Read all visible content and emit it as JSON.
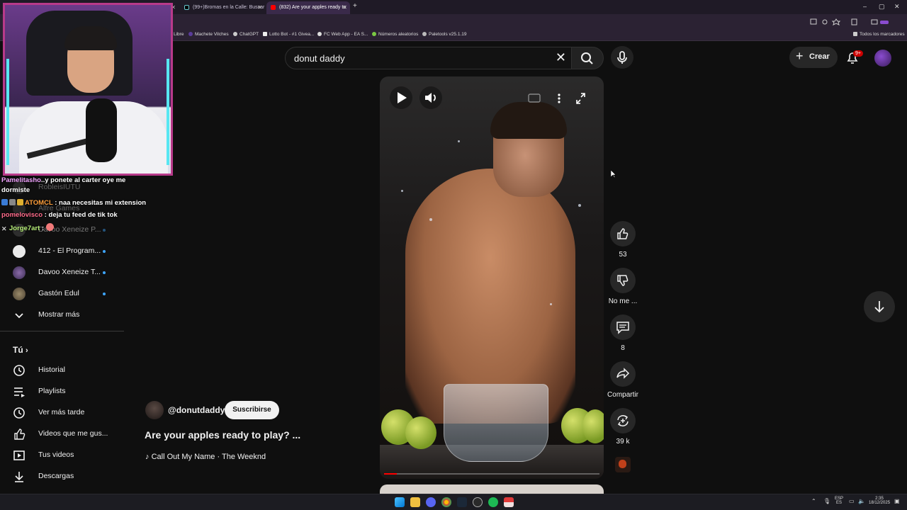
{
  "browser": {
    "tabs": [
      {
        "title": "",
        "active": false
      },
      {
        "title": "(99+)Bromas en la Calle: Buscar",
        "active": false
      },
      {
        "title": "(832) Are your apples ready to",
        "active": true
      }
    ],
    "new_tab": "+",
    "bookmarks": [
      "Libre",
      "Machete Vilches",
      "ChatGPT",
      "Lotto Bot - #1 Givea...",
      "FC Web App - EA S...",
      "Números aleatorios",
      "Paletools v25.1.19"
    ],
    "all_bookmarks": "Todos los marcadores",
    "window_controls": [
      "–",
      "▢",
      "✕"
    ]
  },
  "youtube": {
    "search": {
      "value": "donut daddy",
      "clear_icon": "✕"
    },
    "create_label": "Crear",
    "notifications_badge": "9+"
  },
  "chat": [
    {
      "user": "Pamelitasho",
      "text": "..y ponete al carter oye me",
      "user_color": "#f2a4ff"
    },
    {
      "user": "",
      "text": "dormiste",
      "user_color": "#ffffff"
    },
    {
      "user": "ATOMCL",
      "text": ": naa necesitas mi extension",
      "user_color": "#ff9f3b"
    },
    {
      "user": "pomelovisco",
      "text": ": deja tu feed de tik tok",
      "user_color": "#ff6b8a"
    },
    {
      "user": "Jorge7art",
      "text": ":",
      "user_color": "#b9f27a"
    }
  ],
  "sidebar": {
    "faded_channels": [
      "RobleisIUTU",
      "Alfre Games",
      "Davoo Xeneize P..."
    ],
    "channels": [
      {
        "label": "412 - El Program...",
        "live_dot": true
      },
      {
        "label": "Davoo Xeneize T...",
        "live_dot": true
      },
      {
        "label": "Gastón Edul",
        "live_dot": true
      }
    ],
    "show_more": "Mostrar más",
    "you_header": "Tú",
    "you_items": [
      "Historial",
      "Playlists",
      "Ver más tarde",
      "Videos que me gus...",
      "Tus videos",
      "Descargas"
    ]
  },
  "short": {
    "channel": "@donutdaddy",
    "subscribe_label": "Suscribirse",
    "title": "Are your apples ready to play? ...",
    "music": "Call Out My Name · The Weeknd",
    "progress": 0.06,
    "actions": {
      "likes": "53",
      "dislike_label": "No me ...",
      "comments": "8",
      "share_label": "Compartir",
      "remix_count": "39 k"
    }
  },
  "taskbar": {
    "lang_top": "ESP",
    "lang_bottom": "ES",
    "time": "2:35",
    "date": "18/12/2025"
  },
  "colors": {
    "accent": "#ff0000",
    "live_dot": "#3ea6ff",
    "background": "#0f0f0f"
  }
}
